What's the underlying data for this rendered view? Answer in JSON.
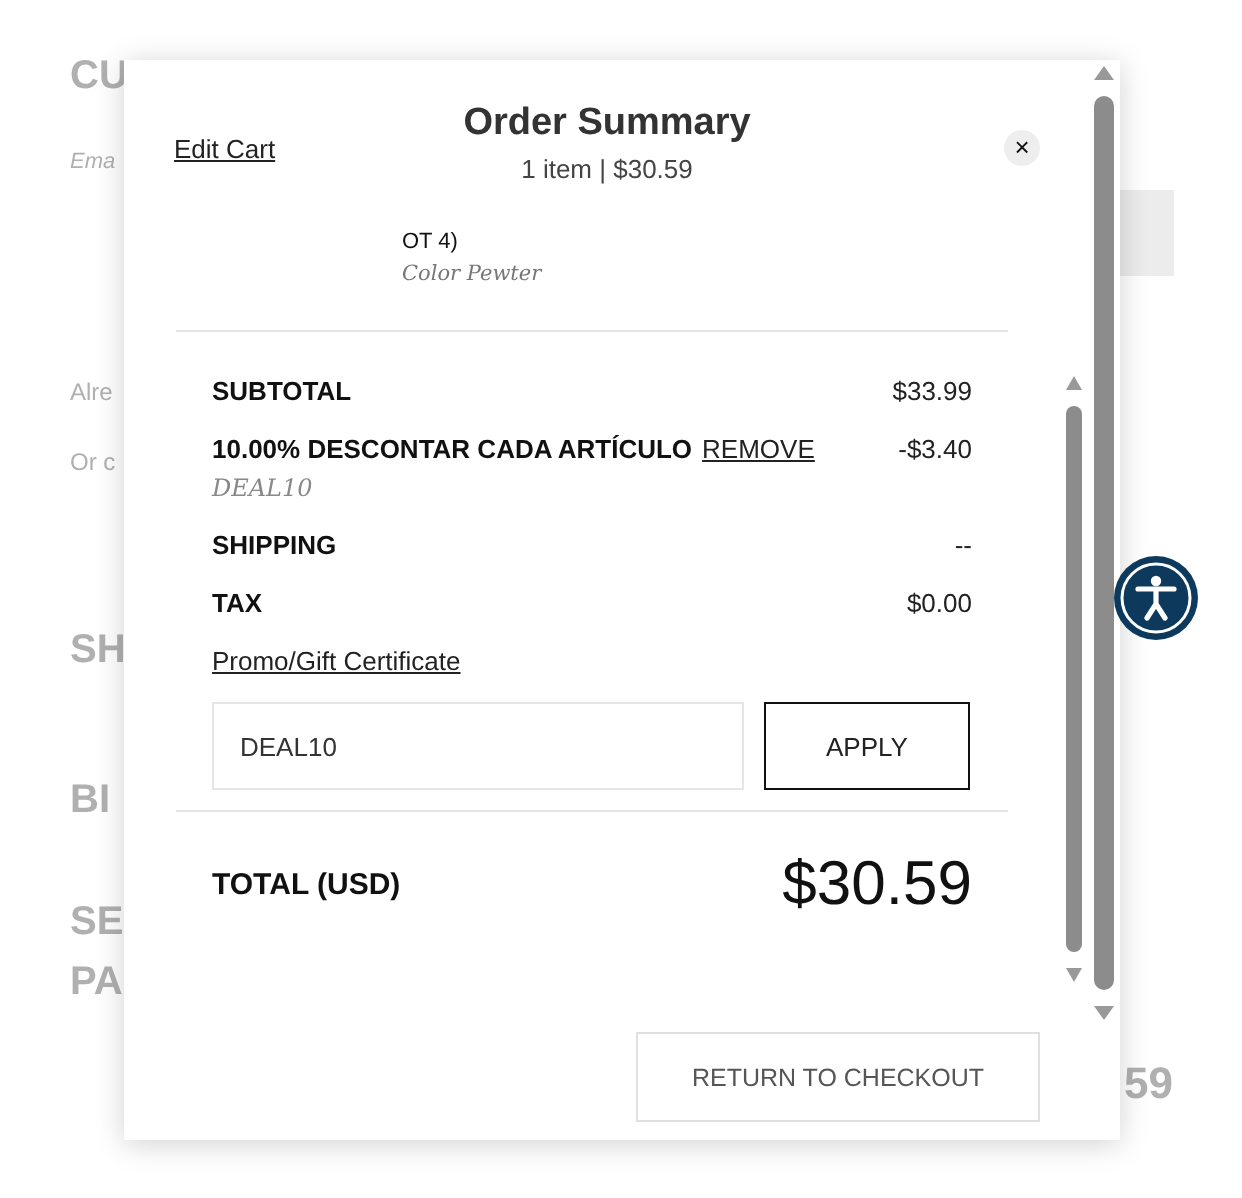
{
  "background": {
    "fragments": [
      {
        "kind": "heading",
        "text": "CU"
      },
      {
        "kind": "note",
        "text": "Ema"
      },
      {
        "kind": "body",
        "text": "Alre"
      },
      {
        "kind": "body",
        "text": "Or c"
      },
      {
        "kind": "heading",
        "text": "SH"
      },
      {
        "kind": "heading",
        "text": "BI"
      },
      {
        "kind": "heading",
        "text": "SE"
      },
      {
        "kind": "heading",
        "text": "PA"
      }
    ],
    "price_fragment": "59"
  },
  "modal": {
    "edit_link": "Edit Cart",
    "title": "Order Summary",
    "subtitle": "1 item | $30.59",
    "close": "×",
    "item": {
      "name_fragment": "OT 4)",
      "option": "Color Pewter"
    },
    "lines": [
      {
        "kind": "plain",
        "label": "SUBTOTAL",
        "amount": "$33.99"
      },
      {
        "kind": "discount",
        "label": "10.00% DESCONTAR CADA ARTÍCULO",
        "link": "REMOVE",
        "code": "DEAL10",
        "amount": "-$3.40"
      },
      {
        "kind": "plain",
        "label": "SHIPPING",
        "amount": "--"
      },
      {
        "kind": "plain",
        "label": "TAX",
        "amount": "$0.00"
      }
    ],
    "promo_link": "Promo/Gift Certificate",
    "promo_input": {
      "value": "DEAL10"
    },
    "apply_button": "APPLY",
    "total": {
      "label": "TOTAL (USD)",
      "amount": "$30.59"
    },
    "return_button": "RETURN TO CHECKOUT"
  }
}
